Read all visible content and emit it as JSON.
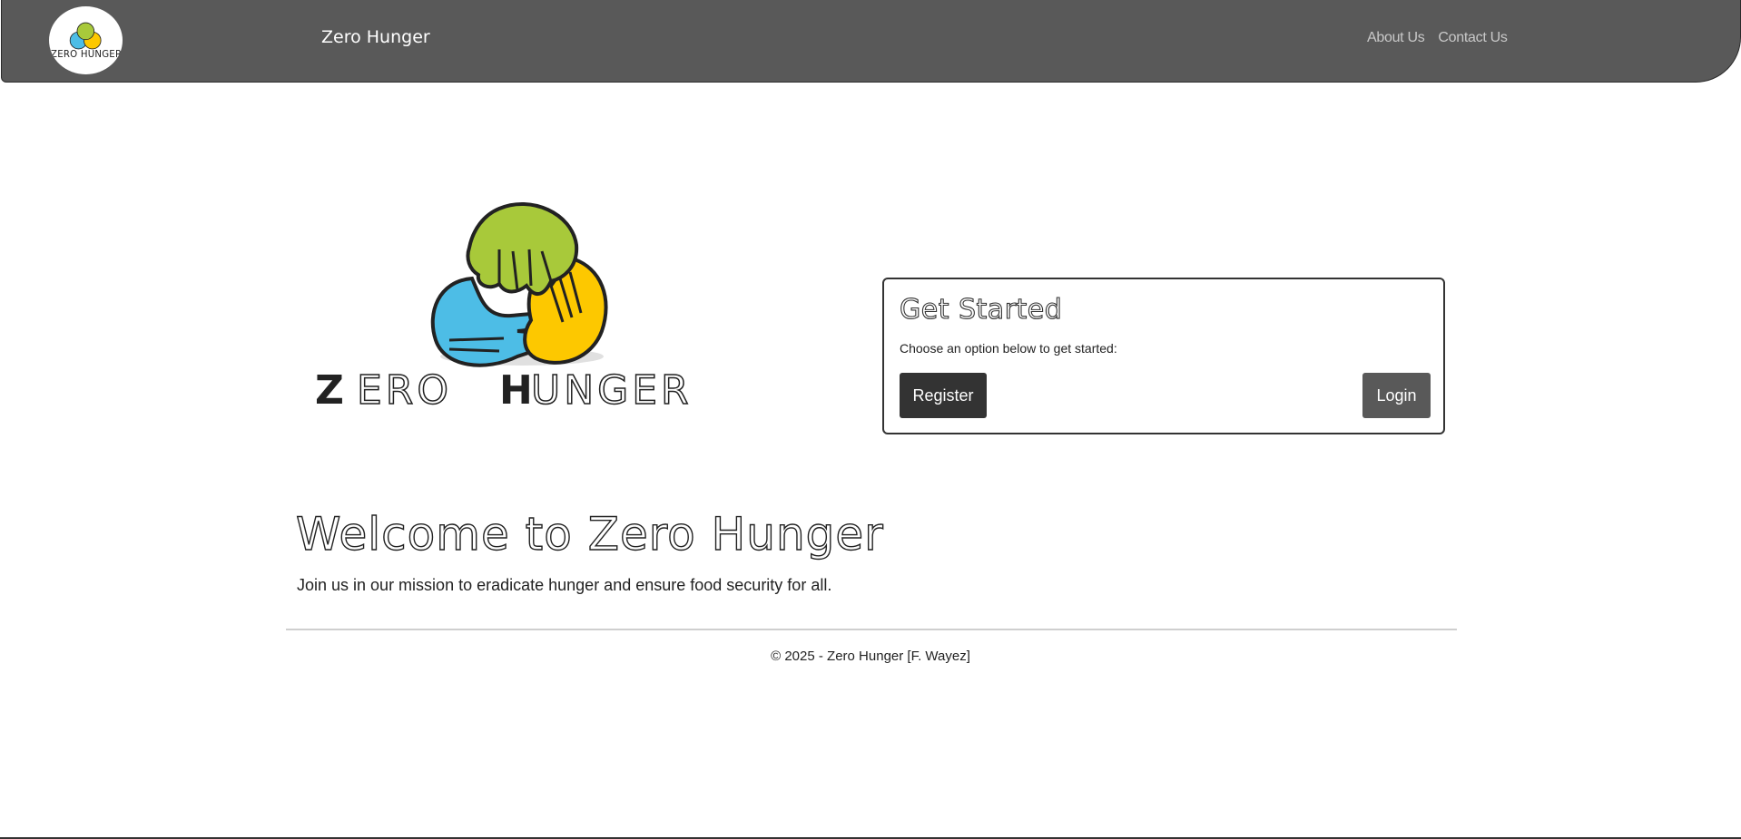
{
  "header": {
    "brand_name": "Zero Hunger",
    "logo_text": "ZERO HUNGER",
    "nav": [
      {
        "label": "About Us"
      },
      {
        "label": "Contact Us"
      }
    ]
  },
  "hero": {
    "logo_text_part1": "Z",
    "logo_text_part2": "ERO",
    "logo_text_part3": "H",
    "logo_text_part4": "UNGER"
  },
  "card": {
    "title": "Get Started",
    "text": "Choose an option below to get started:",
    "register_label": "Register",
    "login_label": "Login"
  },
  "welcome": {
    "title": "Welcome to Zero Hunger",
    "text": "Join us in our mission to eradicate hunger and ensure food security for all."
  },
  "footer": {
    "text": "© 2025 - Zero Hunger [F. Wayez]"
  },
  "colors": {
    "navbar": "#595959",
    "hand_green": "#a8c93a",
    "hand_blue": "#4dbde6",
    "hand_yellow": "#fdc800",
    "button_dark": "#333333",
    "button_gray": "#595959"
  },
  "icons": [
    "zero-hunger-logo"
  ]
}
